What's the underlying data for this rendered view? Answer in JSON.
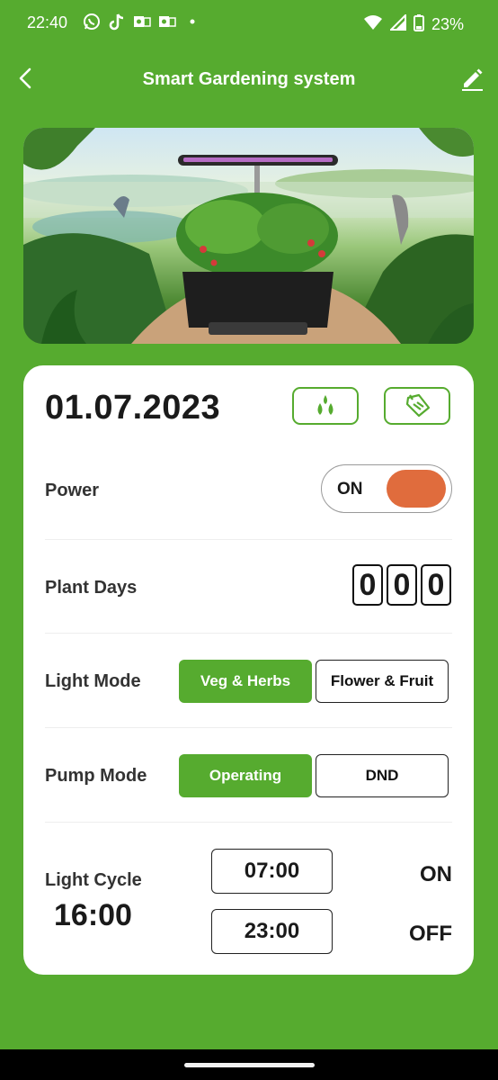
{
  "status_bar": {
    "time": "22:40",
    "battery": "23%",
    "icons": [
      "whatsapp-icon",
      "tiktok-icon",
      "outlook-icon",
      "outlook-icon",
      "dot-icon",
      "wifi-icon",
      "signal-icon",
      "battery-icon"
    ]
  },
  "header": {
    "title": "Smart Gardening system",
    "back_icon": "chevron-left-icon",
    "edit_icon": "pencil-icon"
  },
  "hero": {
    "image": "indoor-garden-planter-illustration"
  },
  "panel": {
    "date": "01.07.2023",
    "water_icon": "water-drops-icon",
    "nutrient_icon": "nutrient-packet-icon",
    "power": {
      "label": "Power",
      "state": "ON",
      "on": true
    },
    "plant_days": {
      "label": "Plant Days",
      "digits": [
        "0",
        "0",
        "0"
      ]
    },
    "light_mode": {
      "label": "Light Mode",
      "options": [
        "Veg & Herbs",
        "Flower & Fruit"
      ],
      "selected": "Veg & Herbs"
    },
    "pump_mode": {
      "label": "Pump Mode",
      "options": [
        "Operating",
        "DND"
      ],
      "selected": "Operating"
    },
    "light_cycle": {
      "label": "Light Cycle",
      "duration": "16:00",
      "on_time": "07:00",
      "on_label": "ON",
      "off_time": "23:00",
      "off_label": "OFF"
    }
  },
  "colors": {
    "accent": "#56ab2f",
    "toggle_knob": "#e06c3d",
    "card": "#ffffff"
  }
}
